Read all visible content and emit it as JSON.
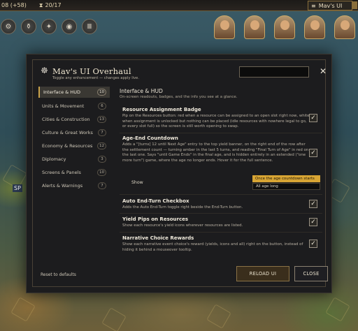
{
  "topbar": {
    "resource_text": "08 (+58)",
    "turn_text": "20/17",
    "mod_title": "Mav's UI"
  },
  "map": {
    "city_label": "SP"
  },
  "dialog": {
    "title": "Mav's UI Overhaul",
    "subtitle": "Toggle any enhancement — changes apply live.",
    "search": {
      "value": "",
      "placeholder": ""
    },
    "close_glyph": "✕",
    "logo_icon": "gear-skull-icon"
  },
  "sidebar": {
    "items": [
      {
        "label": "Interface & HUD",
        "count": "10",
        "active": true
      },
      {
        "label": "Units & Movement",
        "count": "6",
        "active": false
      },
      {
        "label": "Cities & Construction",
        "count": "13",
        "active": false
      },
      {
        "label": "Culture & Great Works",
        "count": "7",
        "active": false
      },
      {
        "label": "Economy & Resources",
        "count": "12",
        "active": false
      },
      {
        "label": "Diplomacy",
        "count": "3",
        "active": false
      },
      {
        "label": "Screens & Panels",
        "count": "10",
        "active": false
      },
      {
        "label": "Alerts & Warnings",
        "count": "7",
        "active": false
      }
    ],
    "reset_label": "Reset to defaults"
  },
  "content": {
    "section_title": "Interface & HUD",
    "section_subtitle": "On-screen readouts, badges, and the info you see at a glance.",
    "settings": [
      {
        "name": "Resource Assignment Badge",
        "desc": "Pip on the Resources button: red when a resource can be assigned to an open slot right now, white when assignment is unlocked but nothing can be placed (idle resources with nowhere legal to go, or every slot full) so the screen is still worth opening to swap.",
        "checked": true
      },
      {
        "name": "Age-End Countdown",
        "desc": "Adds a \"[turns] 12 until Next Age\" entry to the top yield banner, on the right end of the row after the settlement count — turning amber in the last 5 turns, and reading \"Final Turn of Age\" in red on the last one. Says \"until Game Ends\" in the final age, and is hidden entirely in an extended (\"one more turn\") game, where the age no longer ends. Hover it for the full sentence.",
        "checked": true,
        "show_label": "Show",
        "dropdown_selected": "Once the age countdown starts",
        "dropdown_other": "All age long"
      },
      {
        "name": "Auto End-Turn Checkbox",
        "desc": "Adds the Auto End-Turn toggle right beside the End-Turn button.",
        "checked": true
      },
      {
        "name": "Yield Pips on Resources",
        "desc": "Show each resource's yield icons wherever resources are listed.",
        "checked": true
      },
      {
        "name": "Narrative Choice Rewards",
        "desc": "Show each narrative event choice's reward (yields, icons and all) right on the button, instead of hiding it behind a mouseover tooltip.",
        "checked": true
      }
    ],
    "check_glyph": "✓"
  },
  "footer": {
    "reload_label": "RELOAD UI",
    "close_label": "CLOSE"
  },
  "colors": {
    "accent_gold": "#d8a534",
    "dialog_bg": "#1c1c1e",
    "border": "#8a7246"
  }
}
